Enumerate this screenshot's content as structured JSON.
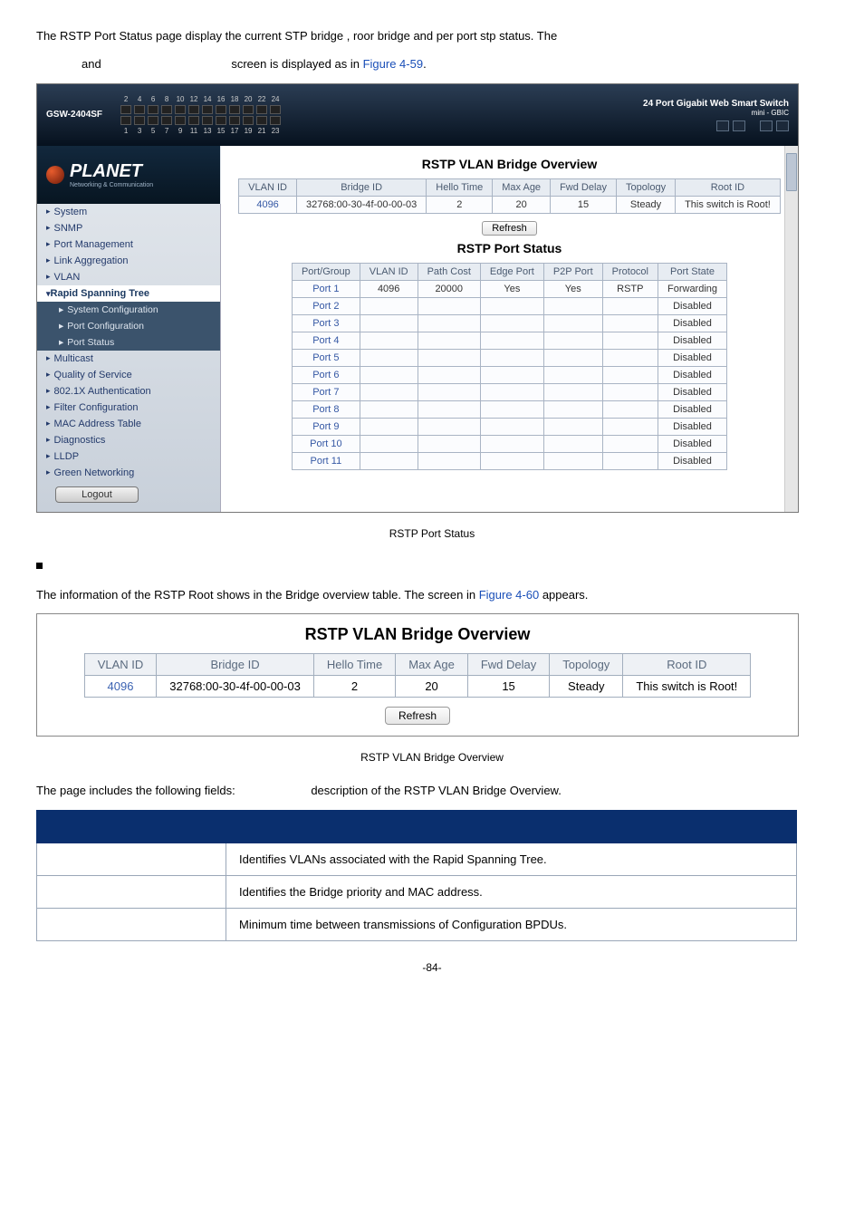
{
  "intro_line_1": "The RSTP Port Status page display the current STP bridge , roor bridge and per port stp status. The",
  "intro_and": "and",
  "intro_line_2": "screen is displayed as in ",
  "intro_figref": "Figure 4-59",
  "intro_period": ".",
  "ss": {
    "model": "GSW-2404SF",
    "top_title": "24 Port Gigabit Web Smart Switch",
    "mini": "mini - GBIC",
    "logo_text": "PLANET",
    "logo_sub": "Networking & Communication",
    "sidebar": {
      "system": "System",
      "snmp": "SNMP",
      "port_mgmt": "Port Management",
      "link_agg": "Link Aggregation",
      "vlan": "VLAN",
      "rstp": "Rapid Spanning Tree",
      "sub_sys": "System Configuration",
      "sub_port_conf": "Port Configuration",
      "sub_port_status": "Port Status",
      "multicast": "Multicast",
      "qos": "Quality of Service",
      "auth": "802.1X Authentication",
      "filter": "Filter Configuration",
      "mac": "MAC Address Table",
      "diag": "Diagnostics",
      "lldp": "LLDP",
      "green": "Green Networking",
      "logout": "Logout"
    },
    "overview_title": "RSTP VLAN Bridge Overview",
    "overview_headers": {
      "vlan_id": "VLAN ID",
      "bridge_id": "Bridge ID",
      "hello": "Hello Time",
      "max_age": "Max Age",
      "fwd": "Fwd Delay",
      "topology": "Topology",
      "root": "Root ID"
    },
    "overview_row": {
      "vlan": "4096",
      "bridge": "32768:00-30-4f-00-00-03",
      "hello": "2",
      "max_age": "20",
      "fwd": "15",
      "topology": "Steady",
      "root": "This switch is Root!"
    },
    "refresh": "Refresh",
    "port_status_title": "RSTP Port Status",
    "port_headers": {
      "pg": "Port/Group",
      "vlan": "VLAN ID",
      "path": "Path Cost",
      "edge": "Edge Port",
      "p2p": "P2P Port",
      "proto": "Protocol",
      "state": "Port State"
    },
    "port_rows": [
      {
        "pg": "Port 1",
        "vlan": "4096",
        "path": "20000",
        "edge": "Yes",
        "p2p": "Yes",
        "proto": "RSTP",
        "state": "Forwarding"
      },
      {
        "pg": "Port 2",
        "vlan": "",
        "path": "",
        "edge": "",
        "p2p": "",
        "proto": "",
        "state": "Disabled"
      },
      {
        "pg": "Port 3",
        "vlan": "",
        "path": "",
        "edge": "",
        "p2p": "",
        "proto": "",
        "state": "Disabled"
      },
      {
        "pg": "Port 4",
        "vlan": "",
        "path": "",
        "edge": "",
        "p2p": "",
        "proto": "",
        "state": "Disabled"
      },
      {
        "pg": "Port 5",
        "vlan": "",
        "path": "",
        "edge": "",
        "p2p": "",
        "proto": "",
        "state": "Disabled"
      },
      {
        "pg": "Port 6",
        "vlan": "",
        "path": "",
        "edge": "",
        "p2p": "",
        "proto": "",
        "state": "Disabled"
      },
      {
        "pg": "Port 7",
        "vlan": "",
        "path": "",
        "edge": "",
        "p2p": "",
        "proto": "",
        "state": "Disabled"
      },
      {
        "pg": "Port 8",
        "vlan": "",
        "path": "",
        "edge": "",
        "p2p": "",
        "proto": "",
        "state": "Disabled"
      },
      {
        "pg": "Port 9",
        "vlan": "",
        "path": "",
        "edge": "",
        "p2p": "",
        "proto": "",
        "state": "Disabled"
      },
      {
        "pg": "Port 10",
        "vlan": "",
        "path": "",
        "edge": "",
        "p2p": "",
        "proto": "",
        "state": "Disabled"
      },
      {
        "pg": "Port 11",
        "vlan": "",
        "path": "",
        "edge": "",
        "p2p": "",
        "proto": "",
        "state": "Disabled"
      }
    ]
  },
  "fig1_caption": "RSTP Port Status",
  "para2_a": "The information of the RSTP Root shows in the Bridge overview table. The screen in ",
  "para2_link": "Figure 4-60",
  "para2_b": " appears.",
  "fig2": {
    "title": "RSTP VLAN Bridge Overview",
    "headers": {
      "vlan": "VLAN ID",
      "bridge": "Bridge ID",
      "hello": "Hello Time",
      "max": "Max Age",
      "fwd": "Fwd Delay",
      "topo": "Topology",
      "root": "Root ID"
    },
    "row": {
      "vlan": "4096",
      "bridge": "32768:00-30-4f-00-00-03",
      "hello": "2",
      "max": "20",
      "fwd": "15",
      "topo": "Steady",
      "root": "This switch is Root!"
    },
    "refresh": "Refresh"
  },
  "fig2_caption": "RSTP VLAN Bridge Overview",
  "fields_line_a": "The page includes the following fields:",
  "fields_line_b": "description of the RSTP VLAN Bridge Overview.",
  "desc_rows": {
    "d1": "Identifies VLANs associated with the Rapid Spanning Tree.",
    "d2": "Identifies the Bridge priority and MAC address.",
    "d3": "Minimum time between transmissions of Configuration BPDUs."
  },
  "page_num": "-84-"
}
